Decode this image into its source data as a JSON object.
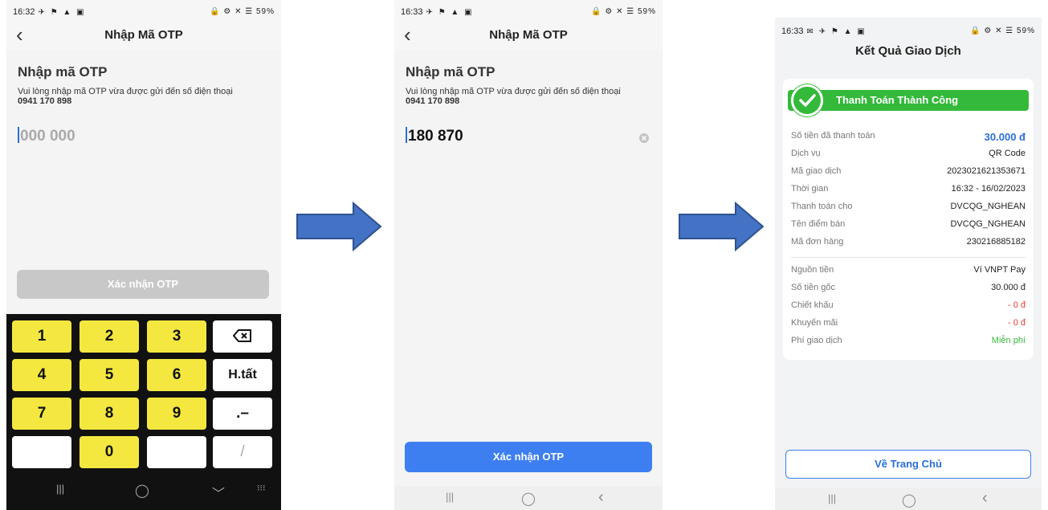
{
  "screen1": {
    "status": {
      "time": "16:32",
      "icons": "✈ ⚑ ▲ ▣",
      "right": "🔒 ⚙ ✕ ☰ 59%"
    },
    "title": "Nhập Mã OTP",
    "heading": "Nhập mã OTP",
    "desc": "Vui lòng nhập mã OTP vừa được gửi đến số điện thoại",
    "phone": "0941 170 898",
    "otp_placeholder": "000 000",
    "confirm_label": "Xác nhận OTP",
    "keys": [
      "1",
      "2",
      "3",
      "⌫",
      "4",
      "5",
      "6",
      "H.tất",
      "7",
      "8",
      "9",
      ".–",
      "",
      "0",
      "",
      "/"
    ],
    "nav": [
      "|||",
      "◯",
      "﹀",
      "⁝⁝⁝"
    ]
  },
  "screen2": {
    "status": {
      "time": "16:33",
      "icons": "✈ ⚑ ▲ ▣",
      "right": "🔒 ⚙ ✕ ☰ 59%"
    },
    "title": "Nhập Mã OTP",
    "heading": "Nhập mã OTP",
    "desc": "Vui lòng nhập mã OTP vừa được gửi đến số điện thoại",
    "phone": "0941 170 898",
    "otp_value": "180 870",
    "clear_icon": "clear-circle-icon",
    "confirm_label": "Xác nhận OTP",
    "nav": [
      "|||",
      "◯",
      "‹"
    ]
  },
  "screen3": {
    "status": {
      "time": "16:33",
      "icons": "✉ ✈ ⚑ ▲ ▣",
      "right": "🔒 ⚙ ✕ ☰ 59%"
    },
    "title": "Kết Quả Giao Dịch",
    "banner": "Thanh Toán Thành Công",
    "rows1": [
      {
        "label": "Số tiền đã thanh toán",
        "value": "30.000 đ"
      },
      {
        "label": "Dịch vụ",
        "value": "QR Code"
      },
      {
        "label": "Mã giao dịch",
        "value": "2023021621353671"
      },
      {
        "label": "Thời gian",
        "value": "16:32 - 16/02/2023"
      },
      {
        "label": "Thanh toán cho",
        "value": "DVCQG_NGHEAN"
      },
      {
        "label": "Tên điểm bán",
        "value": "DVCQG_NGHEAN"
      },
      {
        "label": "Mã đơn hàng",
        "value": "230216885182"
      }
    ],
    "rows2": [
      {
        "label": "Nguồn tiền",
        "value": "Ví VNPT Pay"
      },
      {
        "label": "Số tiền gốc",
        "value": "30.000 đ"
      },
      {
        "label": "Chiết khấu",
        "value": "- 0 đ"
      },
      {
        "label": "Khuyến mãi",
        "value": "- 0 đ"
      },
      {
        "label": "Phí giao dịch",
        "value": "Miễn phí"
      }
    ],
    "home_label": "Về Trang Chủ",
    "nav": [
      "|||",
      "◯",
      "‹"
    ]
  },
  "colors": {
    "primary_blue": "#3d7ff0",
    "success_green": "#34b93a",
    "key_yellow": "#f4e840",
    "arrow_blue": "#4472c4",
    "red": "#e53935"
  }
}
